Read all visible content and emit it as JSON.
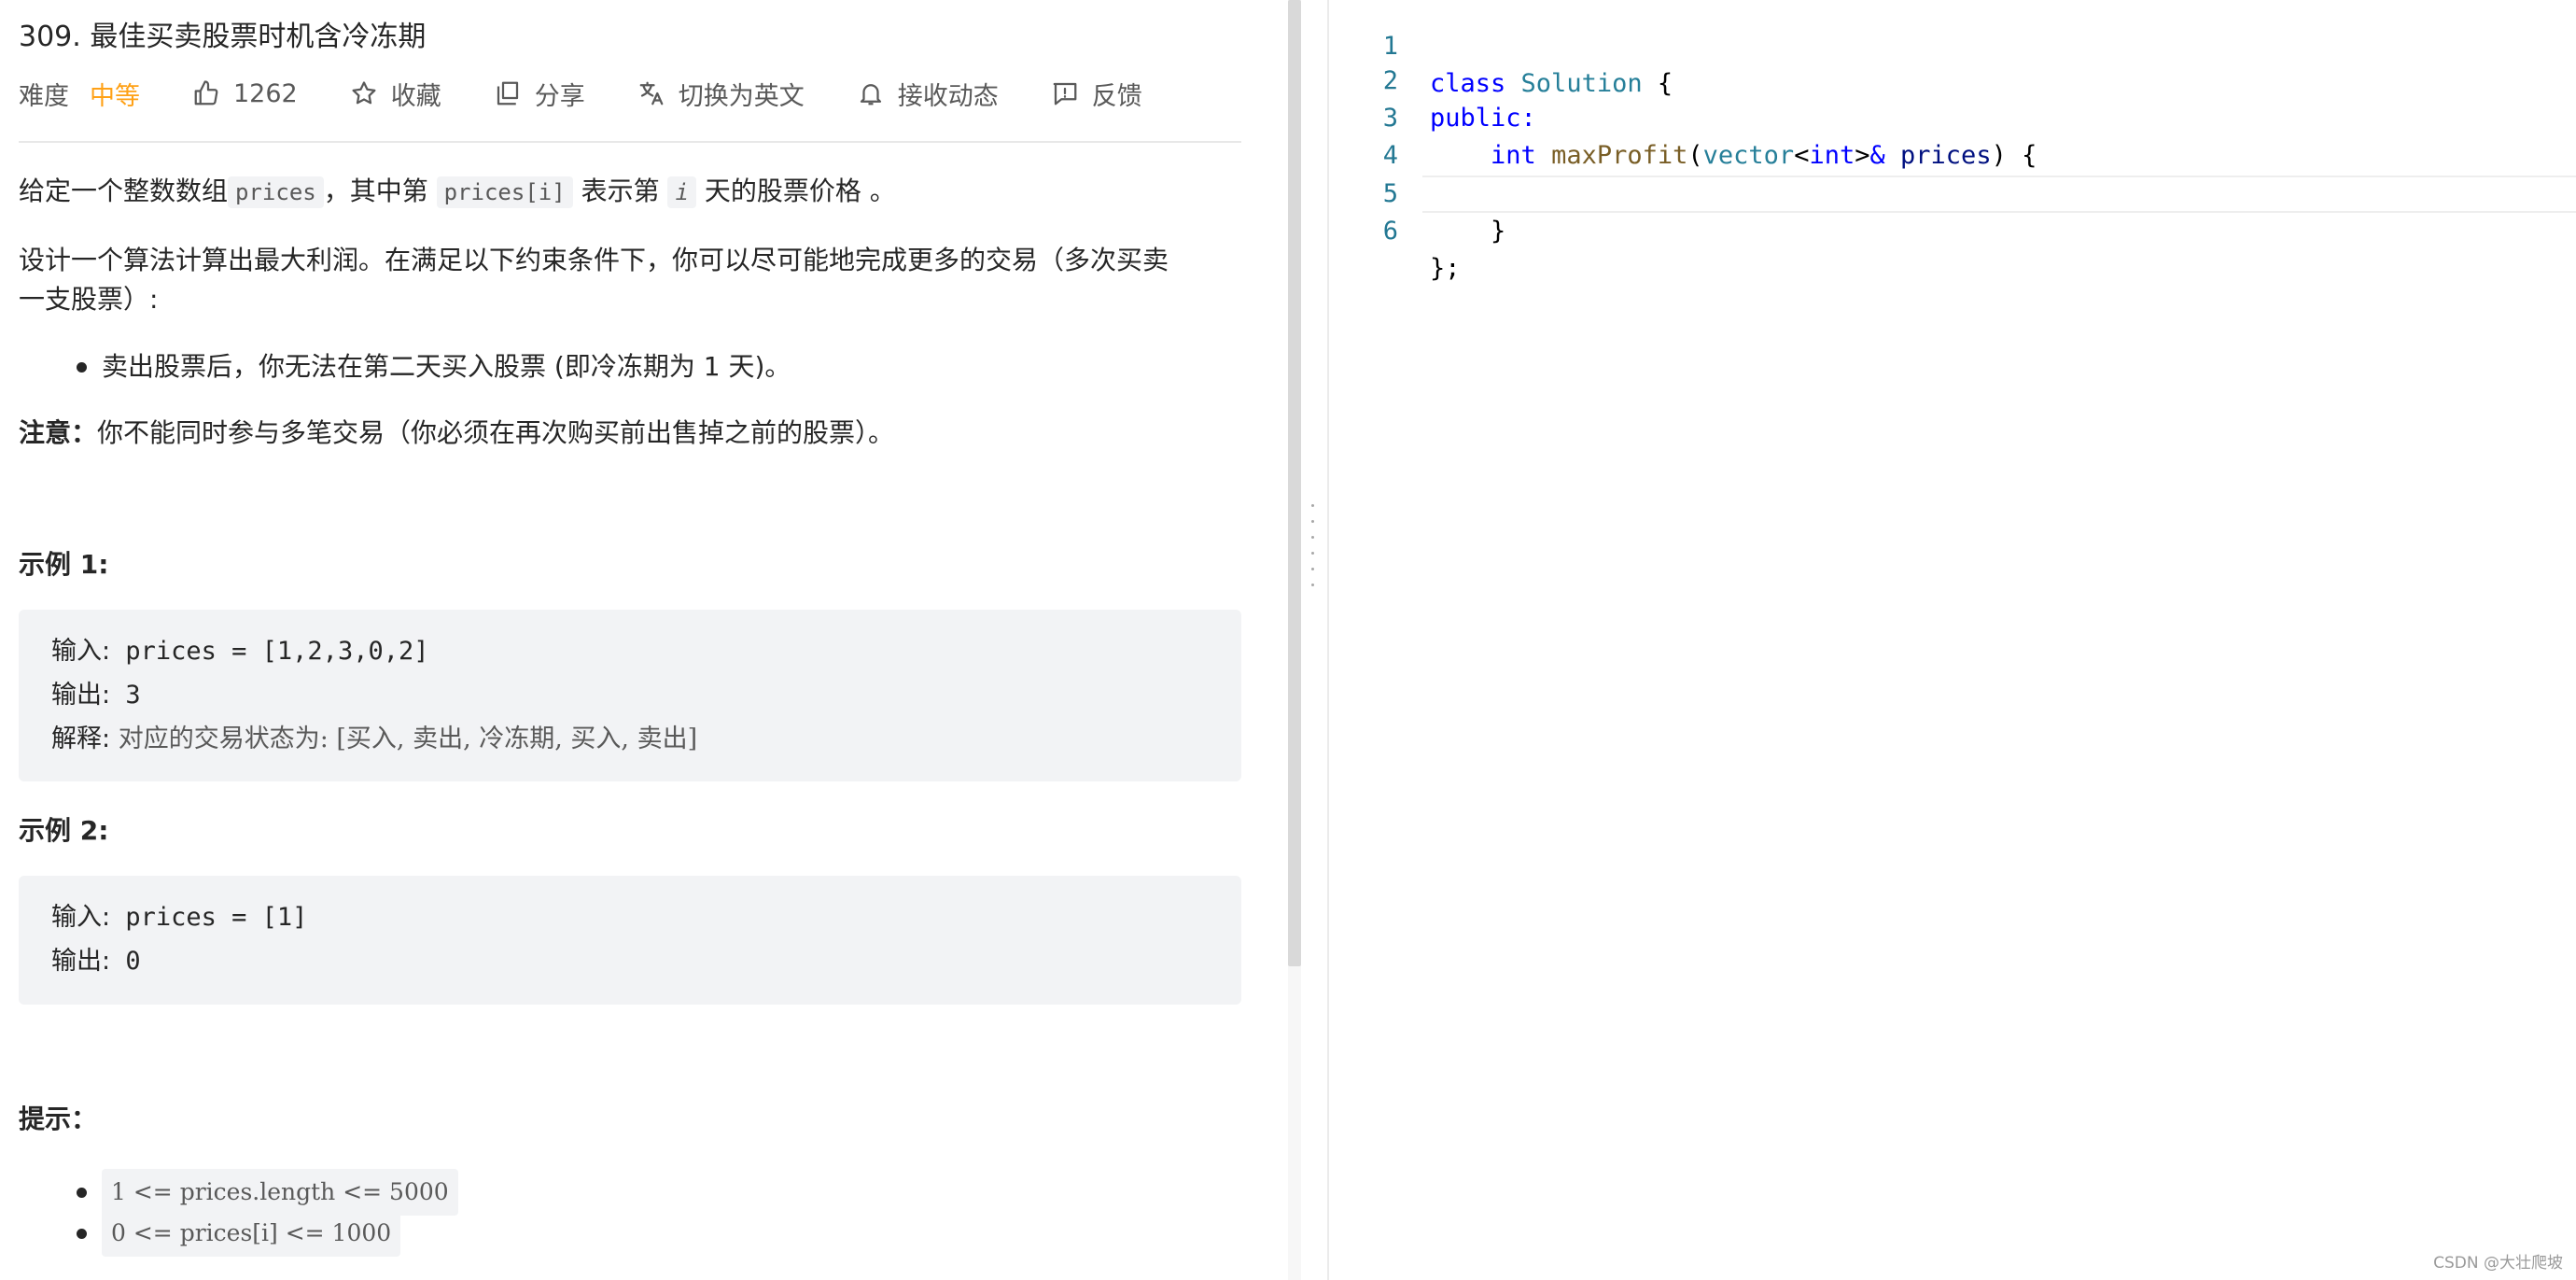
{
  "problem": {
    "title": "309. 最佳买卖股票时机含冷冻期",
    "difficulty_label": "难度",
    "difficulty_value": "中等",
    "likes": "1262",
    "favorite_label": "收藏",
    "share_label": "分享",
    "switch_lang_label": "切换为英文",
    "subscribe_label": "接收动态",
    "feedback_label": "反馈"
  },
  "description": {
    "p1_part1": "给定一个整数数组",
    "p1_code1": "prices",
    "p1_part2": "，其中第 ",
    "p1_code2": "prices[i]",
    "p1_part3": " 表示第 ",
    "p1_code3": "i",
    "p1_part4": " 天的股票价格 。",
    "p2_line1": "设计一个算法计算出最大利润。在满足以下约束条件下，你可以尽可能地完成更多的交易（多次买卖",
    "p2_line2": "一支股票）:",
    "bullet1": "卖出股票后，你无法在第二天买入股票 (即冷冻期为 1 天)。",
    "note_label": "注意：",
    "note_text": "你不能同时参与多笔交易（你必须在再次购买前出售掉之前的股票）。"
  },
  "examples": [
    {
      "heading": "示例 1:",
      "input_label": "输入:",
      "input_value": " prices = [1,2,3,0,2]",
      "output_label": "输出:",
      "output_value": " 3",
      "explain_label": "解释:",
      "explain_value": " 对应的交易状态为: [买入, 卖出, 冷冻期, 买入, 卖出]"
    },
    {
      "heading": "示例 2:",
      "input_label": "输入:",
      "input_value": " prices = [1]",
      "output_label": "输出:",
      "output_value": " 0"
    }
  ],
  "hints": {
    "heading": "提示：",
    "items": [
      "1 <= prices.length <= 5000",
      "0 <= prices[i] <= 1000"
    ]
  },
  "editor": {
    "line_numbers": [
      "1",
      "2",
      "3",
      "4",
      "5",
      "6"
    ],
    "l1_kw": "class",
    "l1_ty": "Solution",
    "l1_rest": " {",
    "l2_kw": "public:",
    "l3_indent": "    ",
    "l3_kw": "int",
    "l3_fn": "maxProfit",
    "l3_p1": "(",
    "l3_ty": "vector",
    "l3_lt": "<",
    "l3_kw2": "int",
    "l3_gt": ">",
    "l3_amp": "&",
    "l3_var": " prices",
    "l3_end": ") {",
    "l5": "    }",
    "l6": "};"
  },
  "watermark": "CSDN @大壮爬坡",
  "colors": {
    "accent": "#ffa116",
    "keyword": "#0000ff",
    "type": "#267f99",
    "function": "#795e26",
    "variable": "#001080",
    "line_number": "#237893"
  },
  "icons": [
    "thumbs-up-icon",
    "star-icon",
    "share-icon",
    "translate-icon",
    "bell-icon",
    "feedback-icon"
  ]
}
